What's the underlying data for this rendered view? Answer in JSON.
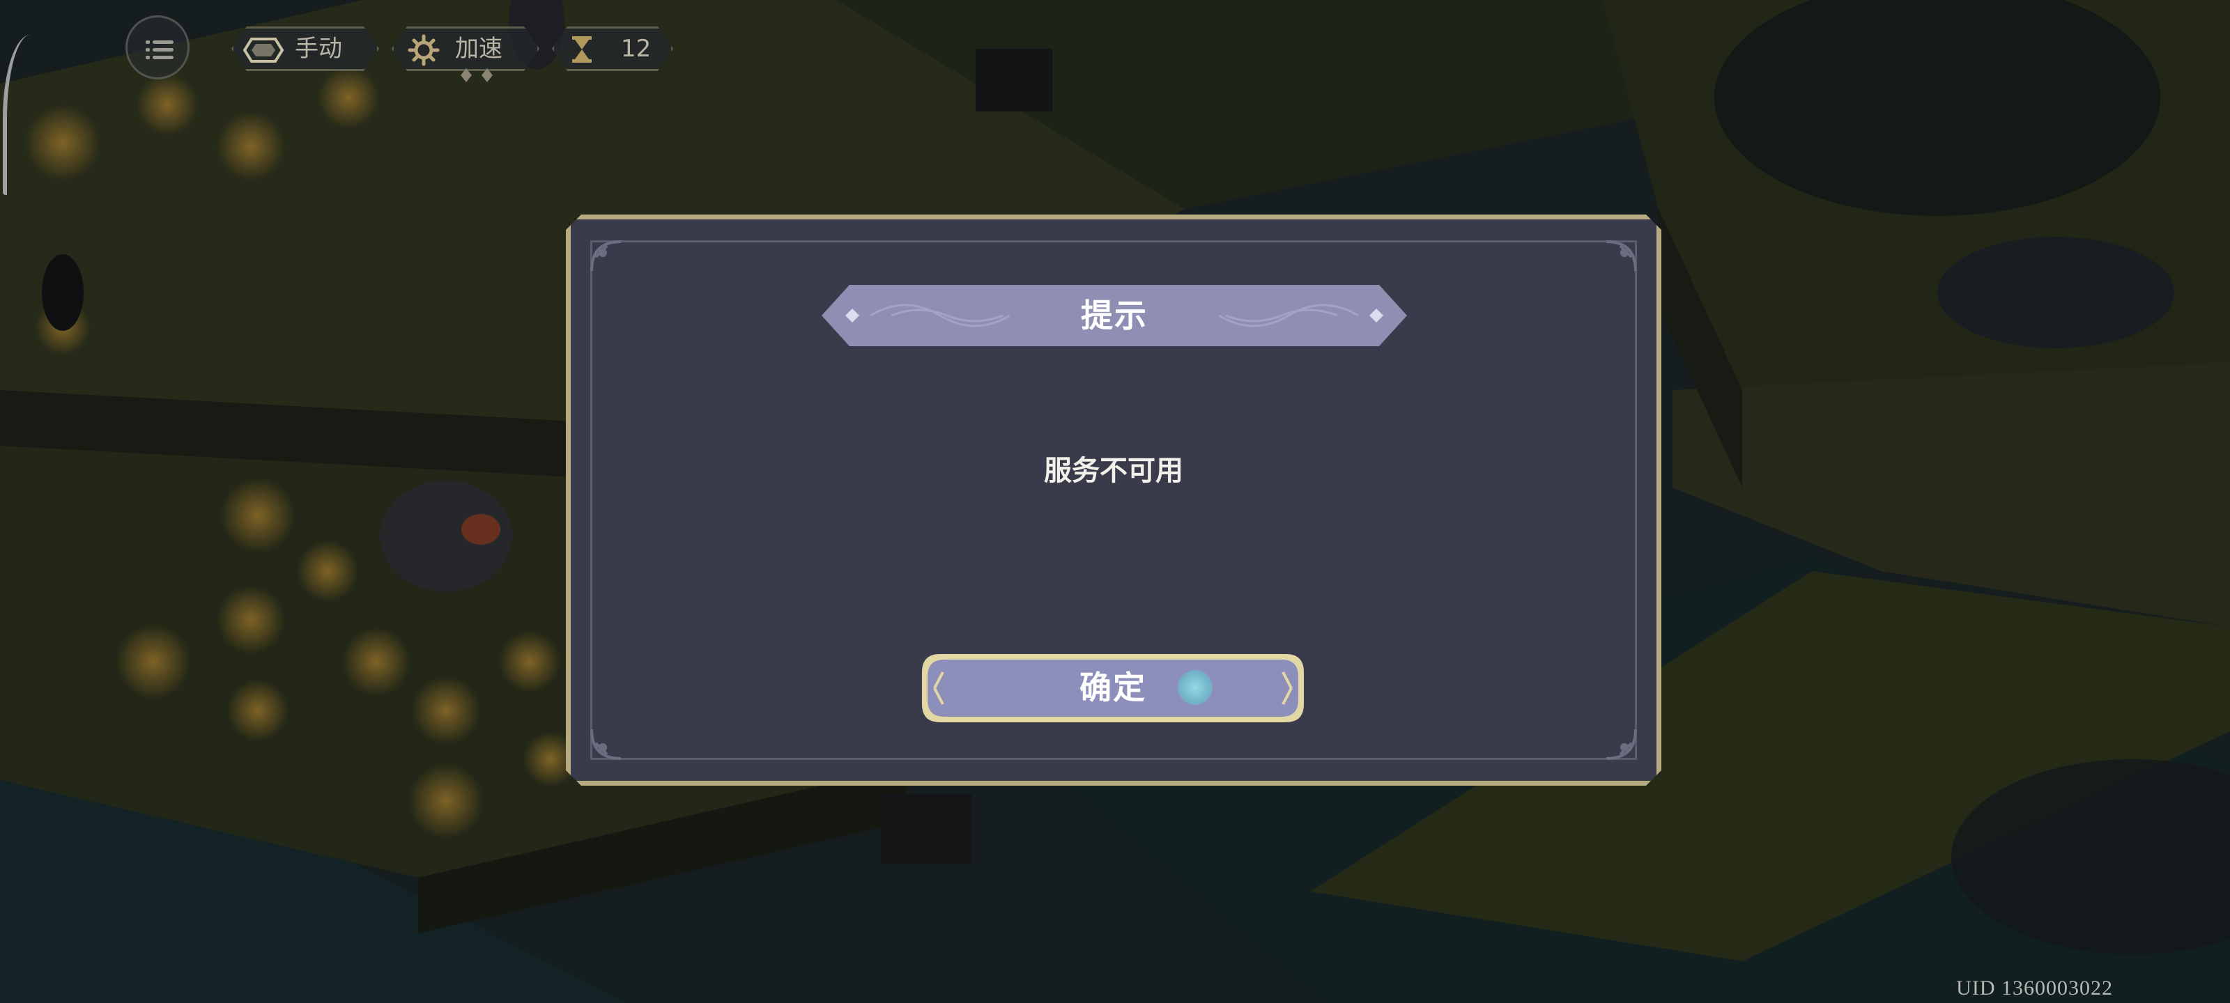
{
  "hud": {
    "mode_label": "手动",
    "speed_label": "加速",
    "timer_value": "12"
  },
  "dialog": {
    "title": "提示",
    "message": "服务不可用",
    "confirm_label": "确定"
  },
  "footer": {
    "uid_prefix": "UID",
    "uid_value": "1360003022"
  },
  "icons": {
    "menu": "menu-icon",
    "mode": "hexagon-icon",
    "speed": "gear-icon",
    "timer": "hourglass-icon"
  },
  "colors": {
    "dialog_bg": "#3a3b4a",
    "dialog_border": "#b7ab81",
    "banner_fill": "#8e8fb2",
    "button_fill": "#8d8fbb",
    "button_border": "#e4d7a6",
    "text_primary": "#ffffff"
  }
}
